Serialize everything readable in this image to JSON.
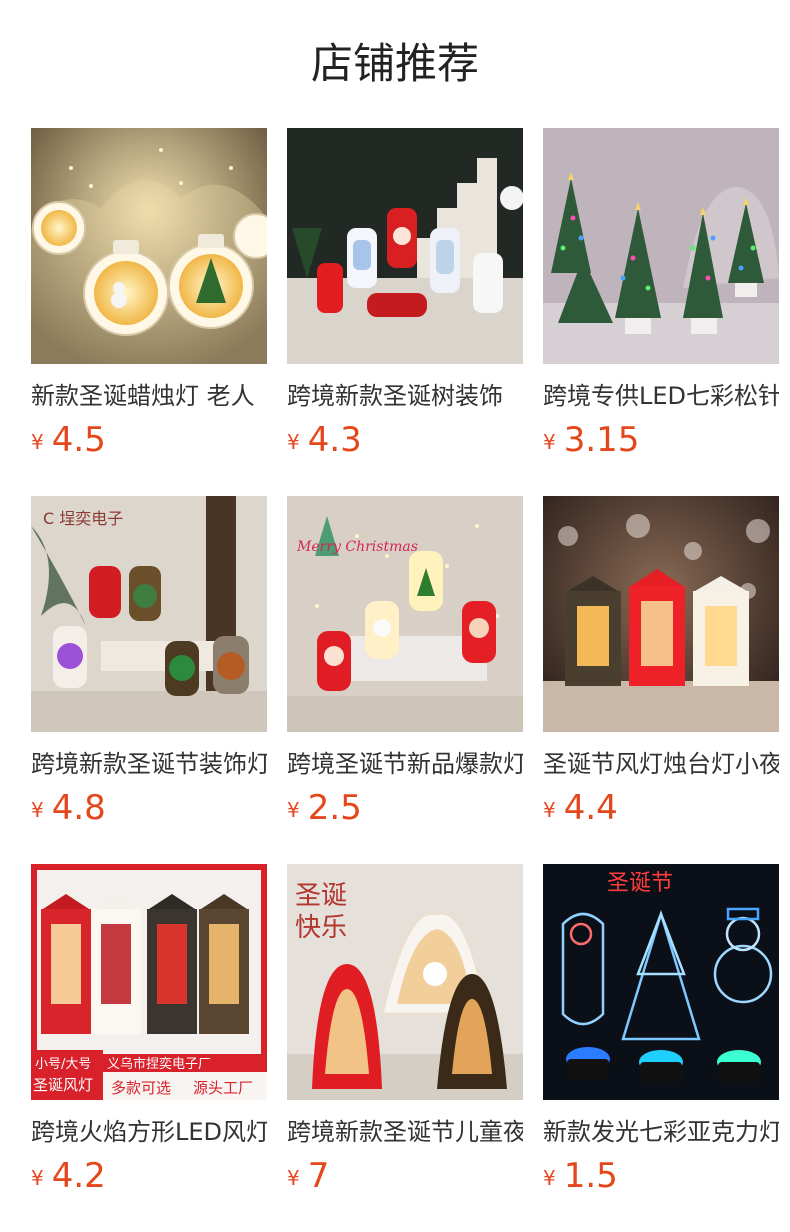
{
  "title": "店铺推荐",
  "products": [
    {
      "name": "新款圣诞蜡烛灯 老人",
      "currency": "¥",
      "price": "4.5",
      "image": "lantern-warm-white-bulbs",
      "bg": "#3b342a"
    },
    {
      "name": "跨境新款圣诞树装饰",
      "currency": "¥",
      "price": "4.3",
      "image": "lanterns-red-white-dark-stairs",
      "bg": "#1f2320"
    },
    {
      "name": "跨境专供LED七彩松针",
      "currency": "¥",
      "price": "3.15",
      "image": "mini-christmas-trees-led",
      "bg": "#b9adb4"
    },
    {
      "name": "跨境新款圣诞节装饰灯",
      "currency": "¥",
      "price": "4.8",
      "image": "oil-lanterns-multicolor",
      "bg": "#d9d3cb"
    },
    {
      "name": "跨境圣诞节新品爆款灯",
      "currency": "¥",
      "price": "2.5",
      "image": "lanterns-merry-christmas-fairylights",
      "bg": "#d6cfc5"
    },
    {
      "name": "圣诞节风灯烛台灯小夜灯",
      "currency": "¥",
      "price": "4.4",
      "image": "hexagon-lanterns-snowflakes",
      "bg": "#2b1f1a"
    },
    {
      "name": "跨境火焰方形LED风灯",
      "currency": "¥",
      "price": "4.2",
      "image": "square-wind-lanterns-red-banner",
      "bg": "#d8212a",
      "overlay": {
        "size_tag": "小号/大号",
        "title_tag": "圣诞风灯",
        "shop": "义乌市捏奕电子厂",
        "variety": "多款可选",
        "factory": "源头工厂"
      }
    },
    {
      "name": "跨境新款圣诞节儿童夜灯",
      "currency": "¥",
      "price": "7",
      "image": "arch-lanterns-chinese-text",
      "bg": "#e2ddd6"
    },
    {
      "name": "新款发光七彩亚克力灯",
      "currency": "¥",
      "price": "1.5",
      "image": "acrylic-led-signs",
      "bg": "#0b0f18"
    }
  ],
  "colors": {
    "price": "#e4471b",
    "title": "#222222",
    "text": "#333333"
  }
}
